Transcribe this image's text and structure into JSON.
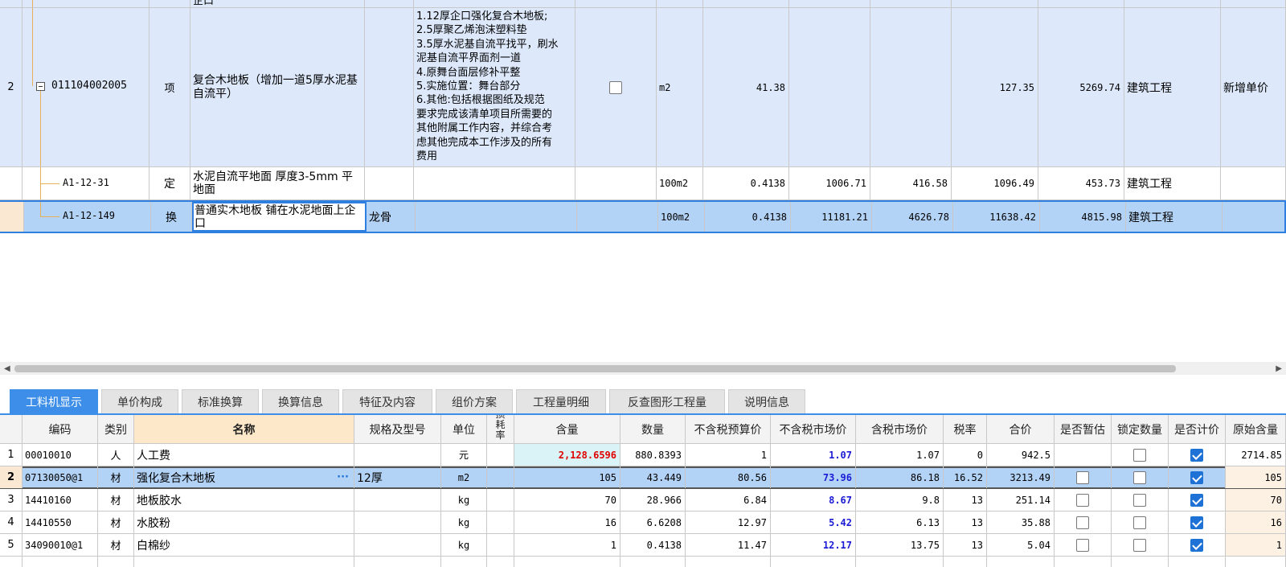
{
  "upper_rows": [
    {
      "seq": "2",
      "code": "011104002005",
      "type": "项",
      "name": "复合木地板（增加一道5厚水泥基自流平）",
      "features": [
        "1.12厚企口强化复合木地板;",
        "2.5厚聚乙烯泡沫塑料垫",
        "3.5厚水泥基自流平找平，刷水",
        "泥基自流平界面剂一道",
        "4.原舞台面层修补平整",
        "5.实施位置：舞台部分",
        "6.其他:包括根据图纸及规范",
        "要求完成该清单项目所需要的",
        "其他附属工作内容，并综合考",
        "虑其他完成本工作涉及的所有",
        "费用"
      ],
      "unit": "m2",
      "qty": "41.38",
      "unit_price": "127.35",
      "total": "5269.74",
      "specialty": "建筑工程",
      "remark": "新增单价"
    },
    {
      "code": "A1-12-31",
      "type": "定",
      "name": "水泥自流平地面 厚度3-5mm 平地面",
      "unit": "100m2",
      "qty": "0.4138",
      "p1": "1006.71",
      "p2": "416.58",
      "p3": "1096.49",
      "total": "453.73",
      "specialty": "建筑工程"
    },
    {
      "code": "A1-12-149",
      "type": "换",
      "name": "普通实木地板 铺在水泥地面上企口",
      "spec": "龙骨",
      "unit": "100m2",
      "qty": "0.4138",
      "p1": "11181.21",
      "p2": "4626.78",
      "p3": "11638.42",
      "total": "4815.98",
      "specialty": "建筑工程"
    }
  ],
  "top_partial": {
    "name_tail": "企口"
  },
  "tabs": [
    {
      "label": "工料机显示"
    },
    {
      "label": "单价构成"
    },
    {
      "label": "标准换算"
    },
    {
      "label": "换算信息"
    },
    {
      "label": "特征及内容"
    },
    {
      "label": "组价方案"
    },
    {
      "label": "工程量明细"
    },
    {
      "label": "反查图形工程量"
    },
    {
      "label": "说明信息"
    }
  ],
  "lower_headers": {
    "code": "编码",
    "cat": "类别",
    "name": "名称",
    "spec": "规格及型号",
    "unit": "单位",
    "loss": "损耗率",
    "content": "含量",
    "qty": "数量",
    "budget_notax": "不含税预算价",
    "market_notax": "不含税市场价",
    "market_tax": "含税市场价",
    "tax": "税率",
    "total": "合价",
    "provisional": "是否暂估",
    "lock_qty": "锁定数量",
    "priced": "是否计价",
    "orig_content": "原始含量"
  },
  "lower_rows": [
    {
      "seq": "1",
      "code": "00010010",
      "cat": "人",
      "name": "人工费",
      "spec": "",
      "unit": "元",
      "content": "2,128.6596",
      "qty": "880.8393",
      "budget": "1",
      "market": "1.07",
      "mtax": "1.07",
      "tax": "0",
      "total": "942.5",
      "provisional": null,
      "lock": false,
      "priced": true,
      "orig": "2714.85"
    },
    {
      "seq": "2",
      "code": "07130050@1",
      "cat": "材",
      "name": "强化复合木地板",
      "spec": "12厚",
      "unit": "m2",
      "content": "105",
      "qty": "43.449",
      "budget": "80.56",
      "market": "73.96",
      "mtax": "86.18",
      "tax": "16.52",
      "total": "3213.49",
      "provisional": false,
      "lock": false,
      "priced": true,
      "orig": "105"
    },
    {
      "seq": "3",
      "code": "14410160",
      "cat": "材",
      "name": "地板胶水",
      "spec": "",
      "unit": "kg",
      "content": "70",
      "qty": "28.966",
      "budget": "6.84",
      "market": "8.67",
      "mtax": "9.8",
      "tax": "13",
      "total": "251.14",
      "provisional": false,
      "lock": false,
      "priced": true,
      "orig": "70"
    },
    {
      "seq": "4",
      "code": "14410550",
      "cat": "材",
      "name": "水胶粉",
      "spec": "",
      "unit": "kg",
      "content": "16",
      "qty": "6.6208",
      "budget": "12.97",
      "market": "5.42",
      "mtax": "6.13",
      "tax": "13",
      "total": "35.88",
      "provisional": false,
      "lock": false,
      "priced": true,
      "orig": "16"
    },
    {
      "seq": "5",
      "code": "34090010@1",
      "cat": "材",
      "name": "白棉纱",
      "spec": "",
      "unit": "kg",
      "content": "1",
      "qty": "0.4138",
      "budget": "11.47",
      "market": "12.17",
      "mtax": "13.75",
      "tax": "13",
      "total": "5.04",
      "provisional": false,
      "lock": false,
      "priced": true,
      "orig": "1"
    }
  ],
  "colors": {
    "selected_row": "#b3d3f6",
    "item_row": "#dde9fb",
    "accent": "#3c8ee8",
    "market_text": "#1b1bd6",
    "content_highlight": "#e00000"
  }
}
